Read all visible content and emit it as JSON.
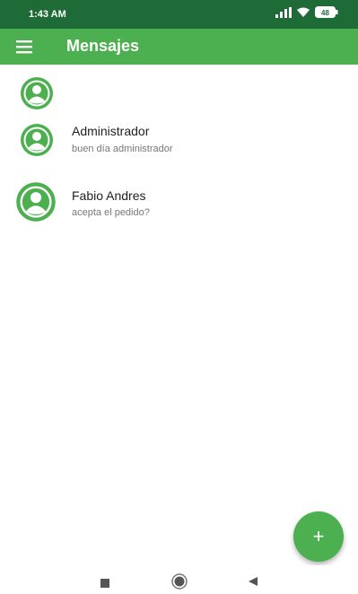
{
  "status_bar": {
    "time": "1:43 AM",
    "icons": [
      "signal-icon",
      "wifi-icon",
      "battery-icon"
    ],
    "battery": "48"
  },
  "app_bar": {
    "menu_icon": "menu-icon",
    "title": "Mensajes",
    "color": "#4caf50"
  },
  "conversations": [
    {
      "name": "",
      "message": ""
    },
    {
      "name": "Administrador",
      "message": "buen día administrador"
    },
    {
      "name": "Fabio Andres",
      "message": "acepta el pedido?"
    }
  ],
  "fab": {
    "icon": "plus-icon",
    "label": "+"
  },
  "nav_bar": {
    "buttons": [
      "recents-square-icon",
      "home-circle-icon",
      "back-triangle-icon"
    ]
  },
  "colors": {
    "primary": "#4caf50",
    "status_bar": "#1e6b38",
    "avatar": "#4caf50"
  }
}
